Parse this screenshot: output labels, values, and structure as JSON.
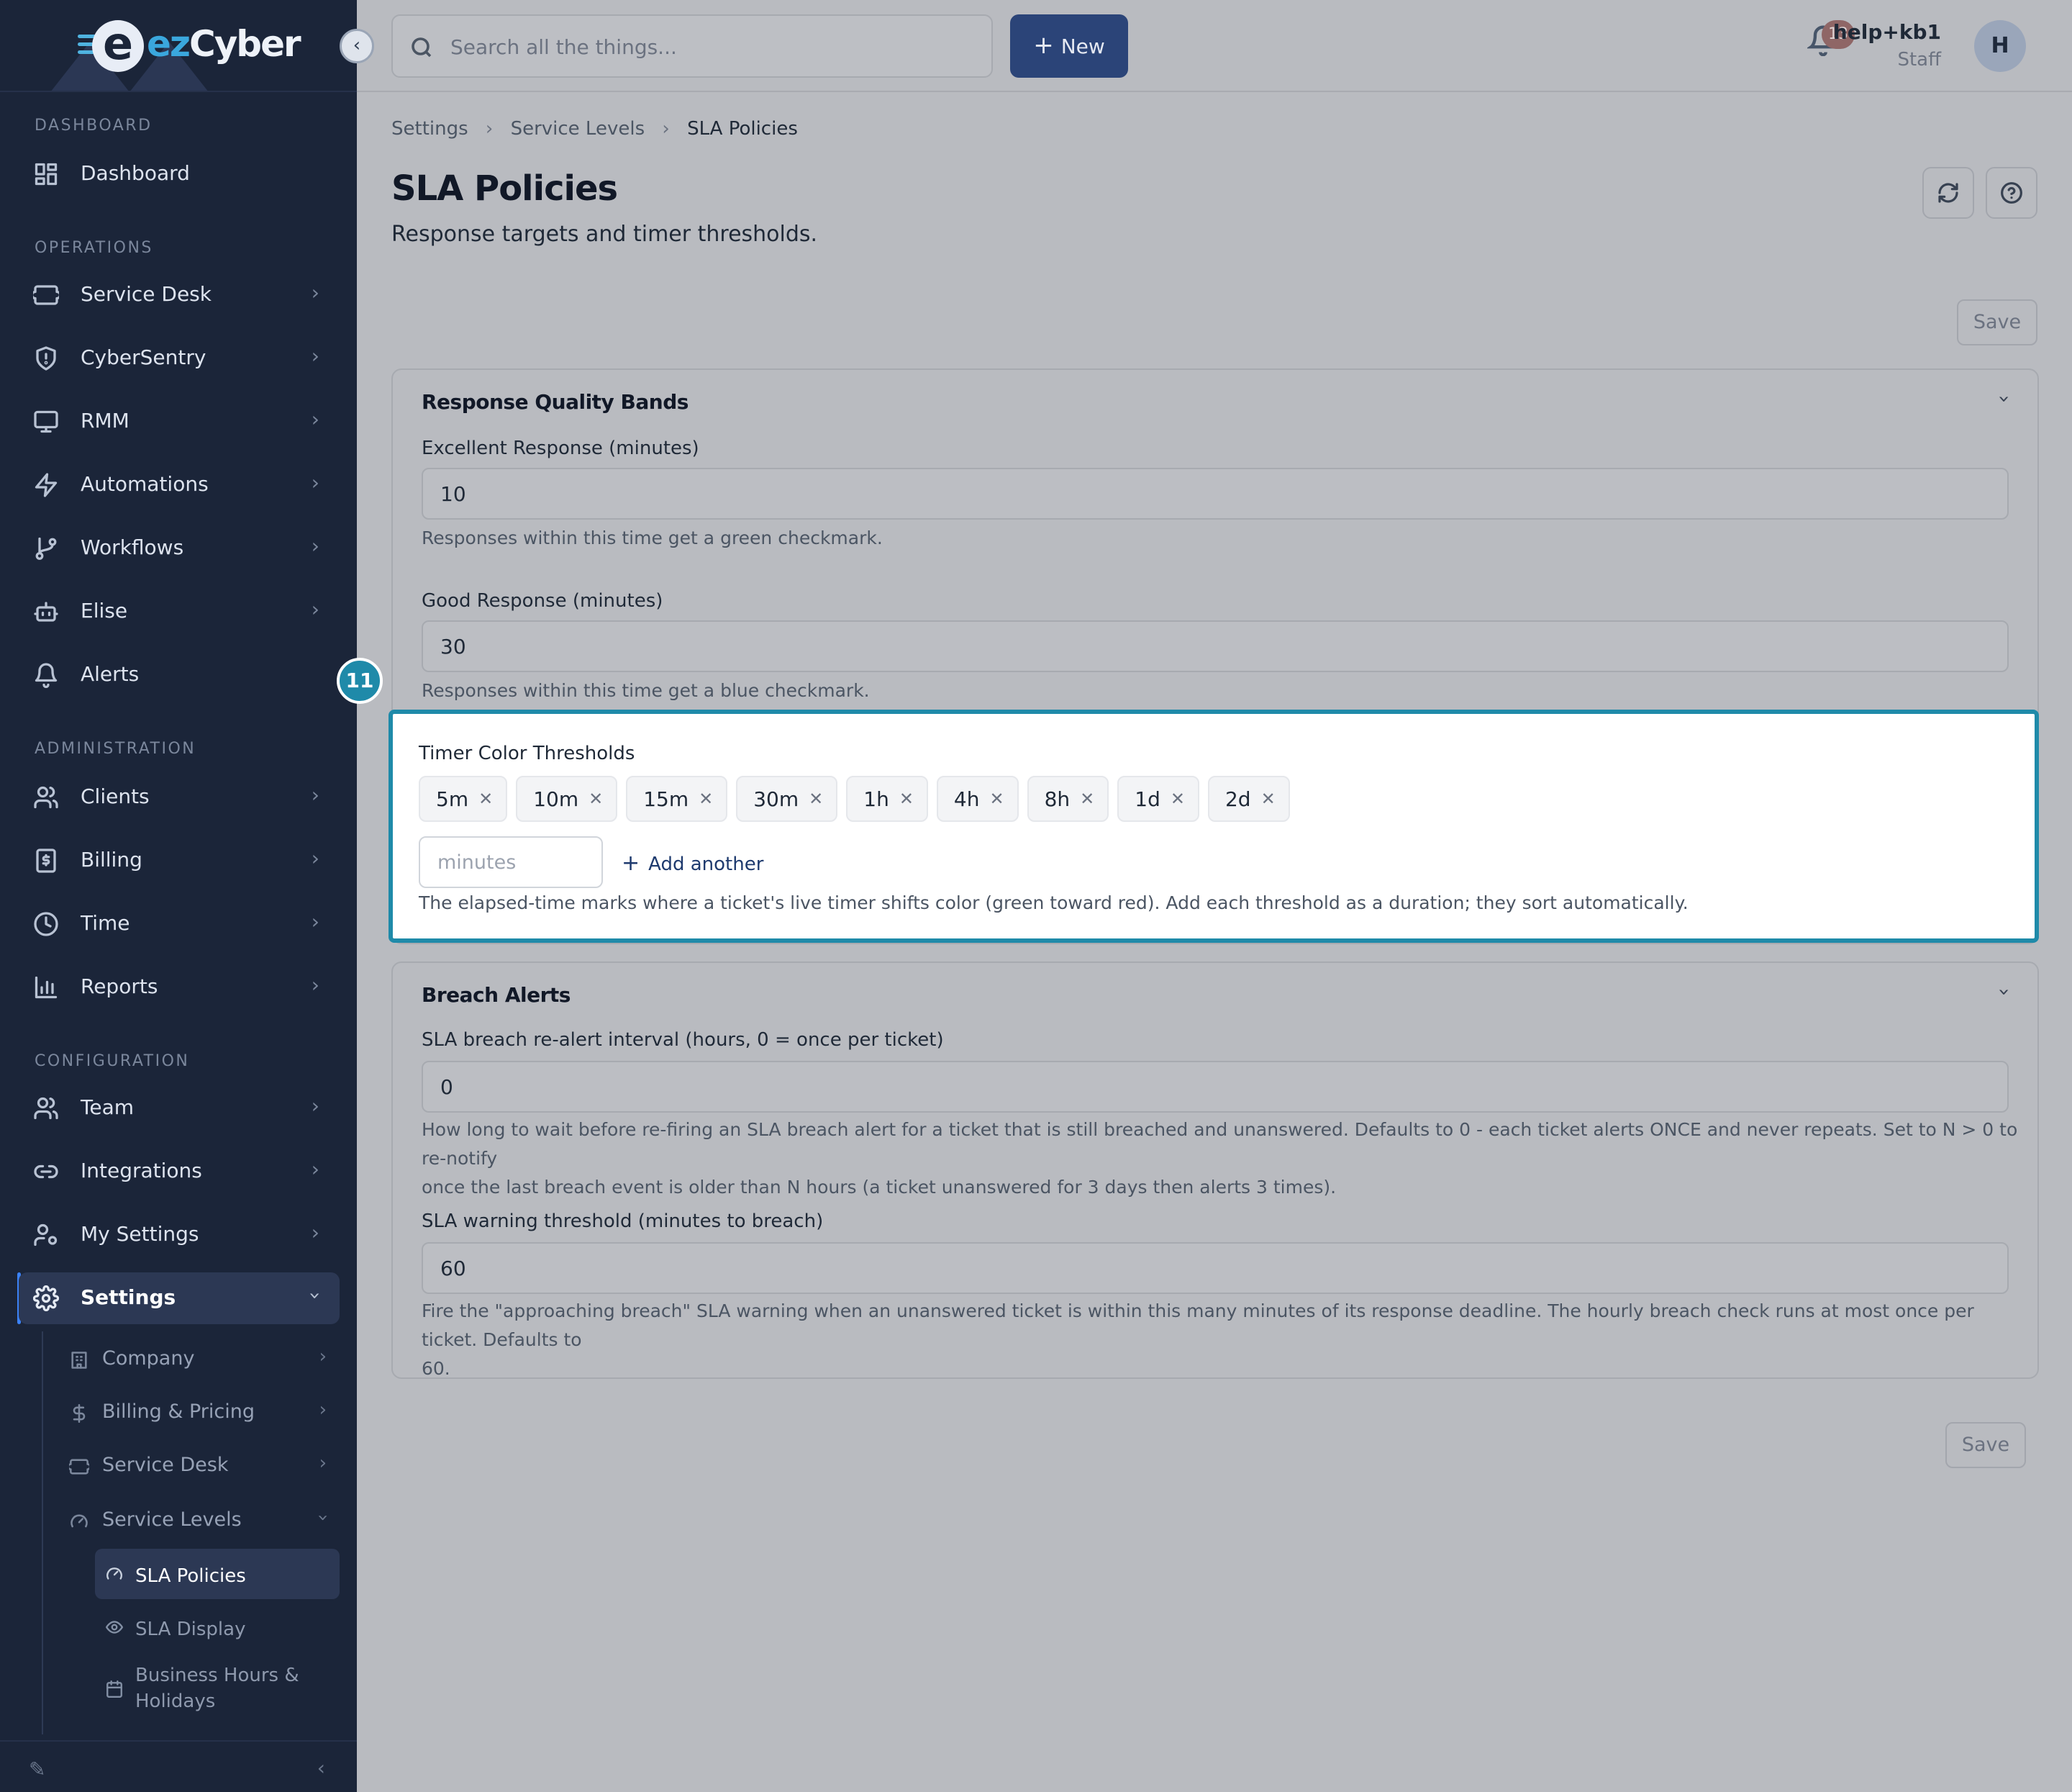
{
  "brand": {
    "logo_mark": "e",
    "name_ez": "ez",
    "name_cyber": "Cyber"
  },
  "sidebar": {
    "sections": {
      "dashboard": "DASHBOARD",
      "operations": "OPERATIONS",
      "administration": "ADMINISTRATION",
      "configuration": "CONFIGURATION"
    },
    "items": {
      "dashboard": "Dashboard",
      "service_desk": "Service Desk",
      "cybersentry": "CyberSentry",
      "rmm": "RMM",
      "automations": "Automations",
      "workflows": "Workflows",
      "elise": "Elise",
      "alerts": "Alerts",
      "clients": "Clients",
      "billing": "Billing",
      "time": "Time",
      "reports": "Reports",
      "team": "Team",
      "integrations": "Integrations",
      "my_settings": "My Settings",
      "settings": "Settings"
    },
    "settings_children": {
      "company": "Company",
      "billing_pricing": "Billing & Pricing",
      "service_desk": "Service Desk",
      "service_levels": "Service Levels"
    },
    "service_levels_children": {
      "sla_policies": "SLA Policies",
      "sla_display": "SLA Display",
      "business_hours": "Business Hours &",
      "business_hours_2": "Holidays"
    }
  },
  "topbar": {
    "search_placeholder": "Search all the things...",
    "new_label": "New",
    "notification_count": "13",
    "user_name": "help+kb1",
    "user_role": "Staff",
    "avatar_initial": "H"
  },
  "breadcrumb": {
    "level1": "Settings",
    "level2": "Service Levels",
    "current": "SLA Policies"
  },
  "page": {
    "title": "SLA Policies",
    "subtitle": "Response targets and timer thresholds.",
    "save_label": "Save"
  },
  "response_bands": {
    "title": "Response Quality Bands",
    "excellent_label": "Excellent Response (minutes)",
    "excellent_value": "10",
    "excellent_help": "Responses within this time get a green checkmark.",
    "good_label": "Good Response (minutes)",
    "good_value": "30",
    "good_help": "Responses within this time get a blue checkmark."
  },
  "timer_thresholds": {
    "step_number": "11",
    "label": "Timer Color Thresholds",
    "chips": [
      "5m",
      "10m",
      "15m",
      "30m",
      "1h",
      "4h",
      "8h",
      "1d",
      "2d"
    ],
    "input_placeholder": "minutes",
    "add_label": "Add another",
    "help": "The elapsed-time marks where a ticket's live timer shifts color (green toward red). Add each threshold as a duration; they sort automatically."
  },
  "breach_alerts": {
    "title": "Breach Alerts",
    "realert_label": "SLA breach re-alert interval (hours, 0 = once per ticket)",
    "realert_value": "0",
    "realert_help_1": "How long to wait before re-firing an SLA breach alert for a ticket that is still breached and unanswered. Defaults to 0 - each ticket alerts ONCE and never repeats. Set to N > 0 to re-notify",
    "realert_help_2": "once the last breach event is older than N hours (a ticket unanswered for 3 days then alerts 3 times).",
    "warning_label": "SLA warning threshold (minutes to breach)",
    "warning_value": "60",
    "warning_help_1": "Fire the \"approaching breach\" SLA warning when an unanswered ticket is within this many minutes of its response deadline. The hourly breach check runs at most once per ticket. Defaults to",
    "warning_help_2": "60."
  },
  "colors": {
    "sidebar_bg": "#1b2539",
    "accent": "#1f8aa9",
    "primary_button": "#2b4478"
  }
}
